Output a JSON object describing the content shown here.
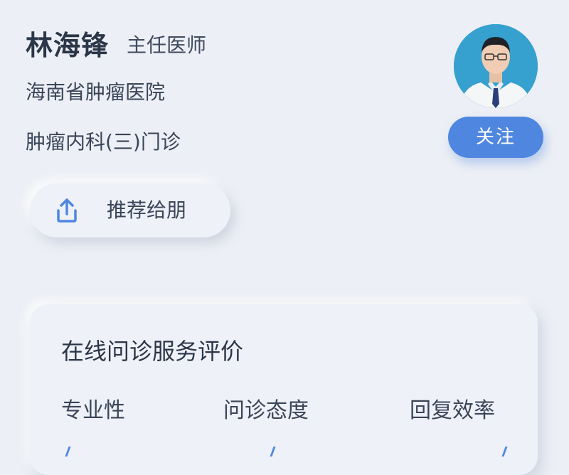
{
  "doctor": {
    "name": "林海锋",
    "title": "主任医师",
    "hospital": "海南省肿瘤医院",
    "department": "肿瘤内科(三)门诊"
  },
  "actions": {
    "share_label": "推荐给朋",
    "follow_label": "关注"
  },
  "icons": {
    "share": "share-upload-icon"
  },
  "colors": {
    "accent": "#4f87e0",
    "background": "#eceff5",
    "avatar_bg": "#3aa0d0"
  },
  "rating": {
    "title": "在线问诊服务评价",
    "metrics": [
      {
        "label": "专业性"
      },
      {
        "label": "问诊态度"
      },
      {
        "label": "回复效率"
      }
    ]
  }
}
